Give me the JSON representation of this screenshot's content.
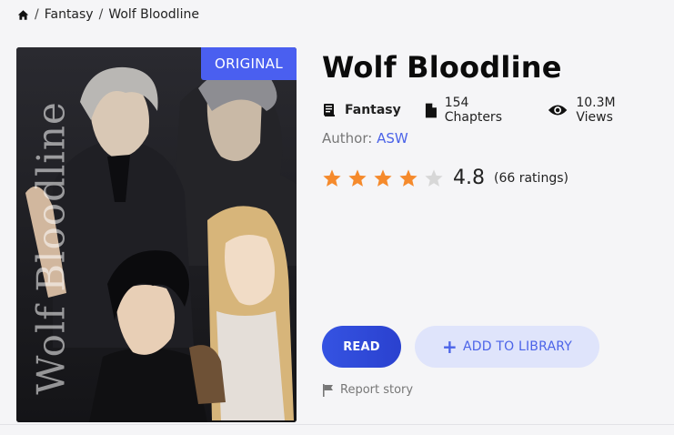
{
  "breadcrumb": {
    "items": [
      "Fantasy",
      "Wolf Bloodline"
    ],
    "separator": "/"
  },
  "book": {
    "title": "Wolf Bloodline",
    "badge": "ORIGINAL",
    "cover_text": "Wolf Bloodline",
    "genre": "Fantasy",
    "chapters": "154 Chapters",
    "views": "10.3M Views",
    "author_label": "Author:",
    "author_name": "ASW"
  },
  "rating": {
    "score": "4.8",
    "count_text": "(66 ratings)",
    "stars_filled": 4,
    "stars_total": 5
  },
  "actions": {
    "read_label": "READ",
    "add_label": "ADD TO LIBRARY",
    "add_icon": "+",
    "report_label": "Report story"
  },
  "colors": {
    "accent": "#4b63e8",
    "badge": "#4a5ff0",
    "star": "#f58a2c",
    "star_empty": "#d7d7d7"
  }
}
